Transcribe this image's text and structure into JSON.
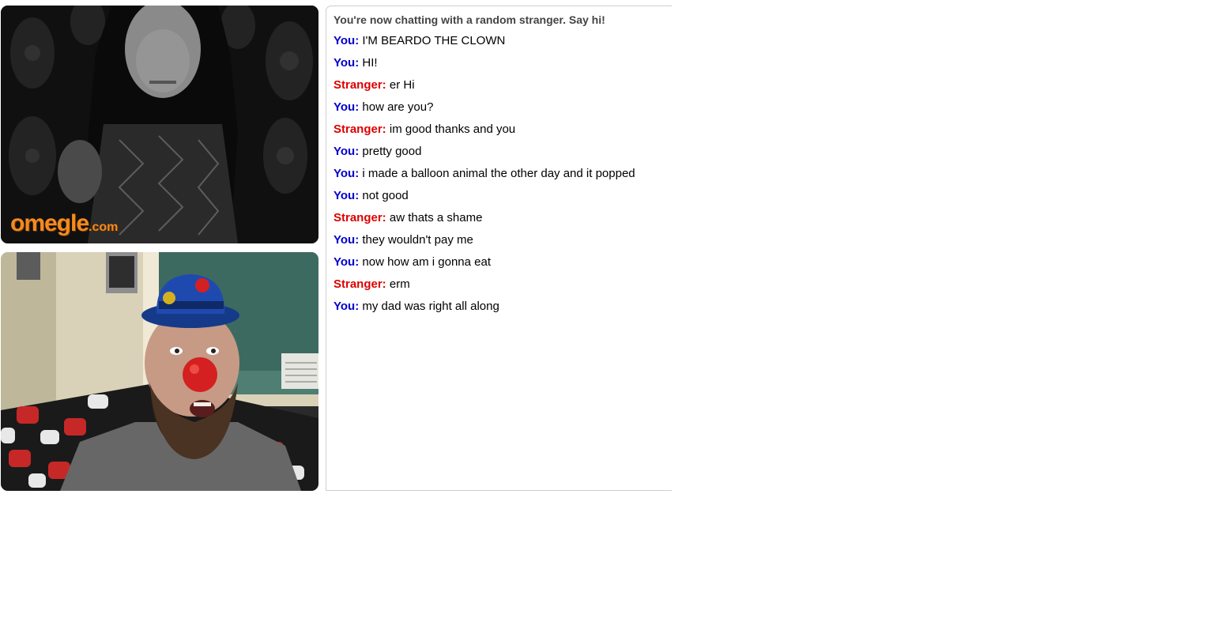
{
  "colors": {
    "you": "#0000cc",
    "stranger": "#dd0000",
    "watermark": "#f58a1f"
  },
  "stranger_video": {
    "watermark_main": "omegle",
    "watermark_suffix": ".com"
  },
  "chat": {
    "status": "You're now chatting with a random stranger. Say hi!",
    "messages": [
      {
        "sender": "you",
        "label": "You:",
        "text": "I'M BEARDO THE CLOWN"
      },
      {
        "sender": "you",
        "label": "You:",
        "text": "HI!"
      },
      {
        "sender": "stranger",
        "label": "Stranger:",
        "text": "er Hi"
      },
      {
        "sender": "you",
        "label": "You:",
        "text": "how are you?"
      },
      {
        "sender": "stranger",
        "label": "Stranger:",
        "text": "im good thanks and you"
      },
      {
        "sender": "you",
        "label": "You:",
        "text": "pretty good"
      },
      {
        "sender": "you",
        "label": "You:",
        "text": "i made a balloon animal the other day and it popped"
      },
      {
        "sender": "you",
        "label": "You:",
        "text": "not good"
      },
      {
        "sender": "stranger",
        "label": "Stranger:",
        "text": "aw thats a shame"
      },
      {
        "sender": "you",
        "label": "You:",
        "text": "they wouldn't pay me"
      },
      {
        "sender": "you",
        "label": "You:",
        "text": "now how am i gonna eat"
      },
      {
        "sender": "stranger",
        "label": "Stranger:",
        "text": "erm"
      },
      {
        "sender": "you",
        "label": "You:",
        "text": "my dad was right all along"
      }
    ]
  }
}
